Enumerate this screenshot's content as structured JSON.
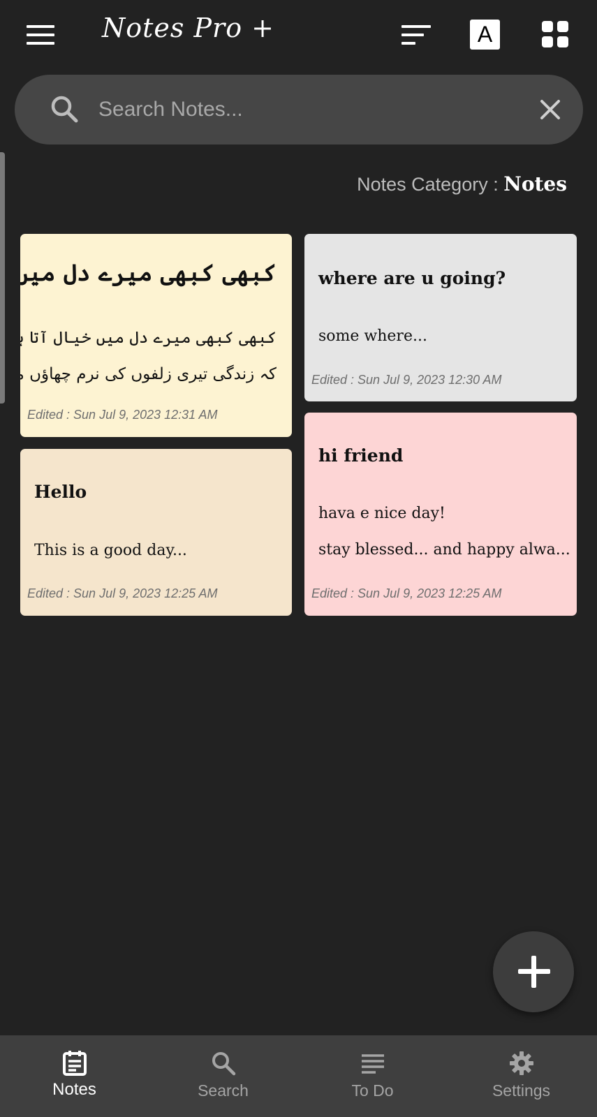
{
  "app_title": "Notes Pro +",
  "toolbar": {
    "menu_icon": "hamburger-menu-icon",
    "sort_icon": "sort-icon",
    "font_button_label": "A",
    "view_icon": "grid-view-icon"
  },
  "search": {
    "placeholder": "Search Notes...",
    "icon": "search-icon",
    "clear_icon": "close-icon"
  },
  "category": {
    "label": "Notes Category :",
    "value": "Notes"
  },
  "notes": [
    {
      "title": "کبھی کبھی میرے دل میں خیال آتا ہے",
      "body": [
        "کبھی کبھی میرے دل میں خیال آتا ہے",
        "کہ زندگی تیری زلفوں کی نرم چھاؤں میں گز..."
      ],
      "edited": "Edited : Sun Jul 9, 2023 12:31 AM",
      "color": "#fdf3d2"
    },
    {
      "title": "where are u going?",
      "body": [
        "some where..."
      ],
      "edited": "Edited : Sun Jul 9, 2023 12:30 AM",
      "color": "#e5e5e5"
    },
    {
      "title": "Hello",
      "body": [
        "This is a good day..."
      ],
      "edited": "Edited : Sun Jul 9, 2023 12:25 AM",
      "color": "#f5e5cc"
    },
    {
      "title": "hi friend",
      "body": [
        "hava e nice day!",
        "stay blessed... and happy alwa..."
      ],
      "edited": "Edited : Sun Jul 9, 2023 12:25 AM",
      "color": "#fdd5d5"
    }
  ],
  "fab": {
    "icon": "add-icon"
  },
  "bottom_nav": [
    {
      "label": "Notes",
      "icon": "notes-icon",
      "active": true
    },
    {
      "label": "Search",
      "icon": "search-icon",
      "active": false
    },
    {
      "label": "To Do",
      "icon": "list-icon",
      "active": false
    },
    {
      "label": "Settings",
      "icon": "gear-icon",
      "active": false
    }
  ],
  "colors": {
    "background": "#222222",
    "search_bar": "#464646",
    "bottom_nav": "#3f3f3f"
  }
}
